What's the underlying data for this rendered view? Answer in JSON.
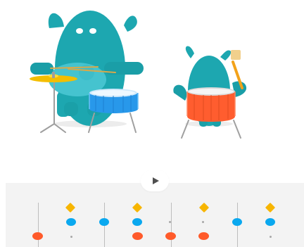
{
  "colors": {
    "monster": "#1da7b0",
    "monster_dark": "#128c94",
    "cymbal": "#f4be00",
    "drum_blue": "#2898ea",
    "drum_orange": "#ff5d2f",
    "sequencer_bg": "#f3f3f3",
    "diamond": "#f7b500",
    "blue_step": "#0aa8ef",
    "orange_step": "#ff5a2a",
    "grey_line": "#bdbdbd"
  },
  "icons": {
    "play": "play-icon"
  },
  "sequencer": {
    "steps": 8,
    "top_row": [
      true,
      false,
      true,
      false,
      true,
      false,
      true,
      false
    ],
    "middle_row": [
      true,
      true,
      true,
      false,
      false,
      true,
      true,
      false
    ],
    "bottom_row": [
      true,
      false,
      true,
      true,
      true,
      false,
      false,
      false
    ]
  }
}
